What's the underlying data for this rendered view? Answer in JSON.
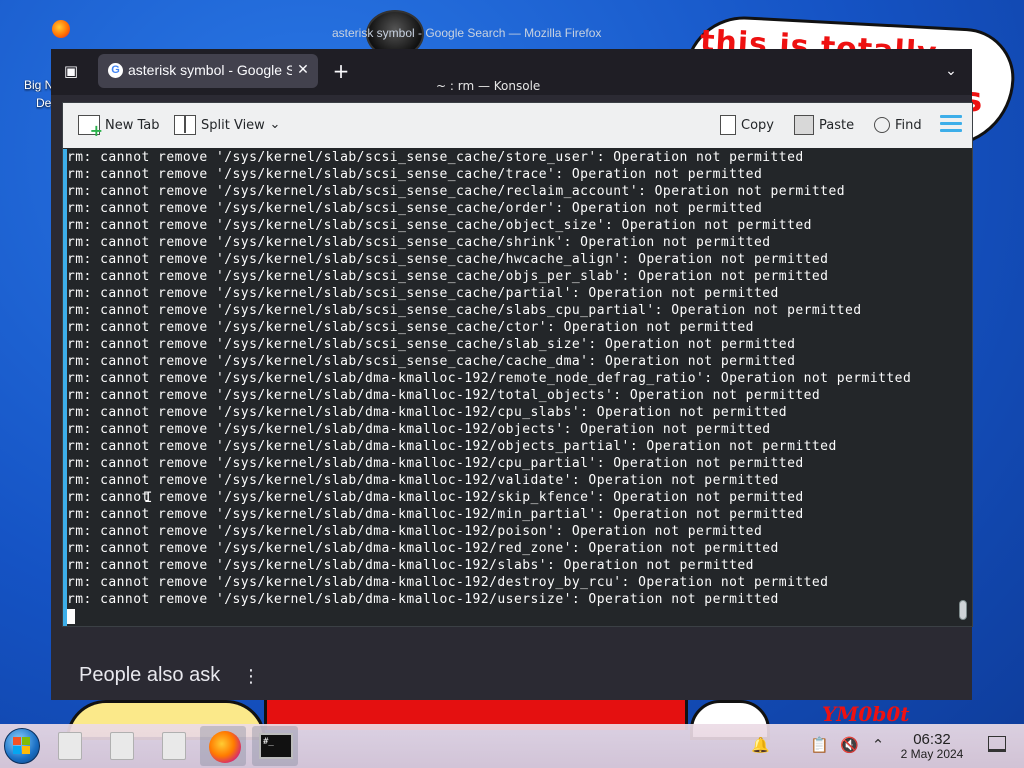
{
  "desktop": {
    "icon_label_line1": "Big N",
    "icon_label_line2": "De",
    "wallpaper_text": "this is totally",
    "wallpaper_text2": "s",
    "wallpaper_signature": "YM0b0t"
  },
  "firefox": {
    "window_title": "asterisk symbol - Google Search — Mozilla Firefox",
    "tab_title": "asterisk symbol - Google Search",
    "tab_favicon": "G",
    "new_tab_label": "+",
    "people_also_ask": "People also ask"
  },
  "konsole": {
    "window_title": "~ : rm — Konsole",
    "toolbar": {
      "new_tab": "New Tab",
      "split_view": "Split View",
      "copy": "Copy",
      "paste": "Paste",
      "find": "Find"
    },
    "lines": [
      "rm: cannot remove '/sys/kernel/slab/scsi_sense_cache/store_user': Operation not permitted",
      "rm: cannot remove '/sys/kernel/slab/scsi_sense_cache/trace': Operation not permitted",
      "rm: cannot remove '/sys/kernel/slab/scsi_sense_cache/reclaim_account': Operation not permitted",
      "rm: cannot remove '/sys/kernel/slab/scsi_sense_cache/order': Operation not permitted",
      "rm: cannot remove '/sys/kernel/slab/scsi_sense_cache/object_size': Operation not permitted",
      "rm: cannot remove '/sys/kernel/slab/scsi_sense_cache/shrink': Operation not permitted",
      "rm: cannot remove '/sys/kernel/slab/scsi_sense_cache/hwcache_align': Operation not permitted",
      "rm: cannot remove '/sys/kernel/slab/scsi_sense_cache/objs_per_slab': Operation not permitted",
      "rm: cannot remove '/sys/kernel/slab/scsi_sense_cache/partial': Operation not permitted",
      "rm: cannot remove '/sys/kernel/slab/scsi_sense_cache/slabs_cpu_partial': Operation not permitted",
      "rm: cannot remove '/sys/kernel/slab/scsi_sense_cache/ctor': Operation not permitted",
      "rm: cannot remove '/sys/kernel/slab/scsi_sense_cache/slab_size': Operation not permitted",
      "rm: cannot remove '/sys/kernel/slab/scsi_sense_cache/cache_dma': Operation not permitted",
      "rm: cannot remove '/sys/kernel/slab/dma-kmalloc-192/remote_node_defrag_ratio': Operation not permitted",
      "rm: cannot remove '/sys/kernel/slab/dma-kmalloc-192/total_objects': Operation not permitted",
      "rm: cannot remove '/sys/kernel/slab/dma-kmalloc-192/cpu_slabs': Operation not permitted",
      "rm: cannot remove '/sys/kernel/slab/dma-kmalloc-192/objects': Operation not permitted",
      "rm: cannot remove '/sys/kernel/slab/dma-kmalloc-192/objects_partial': Operation not permitted",
      "rm: cannot remove '/sys/kernel/slab/dma-kmalloc-192/cpu_partial': Operation not permitted",
      "rm: cannot remove '/sys/kernel/slab/dma-kmalloc-192/validate': Operation not permitted",
      "rm: cannot remove '/sys/kernel/slab/dma-kmalloc-192/skip_kfence': Operation not permitted",
      "rm: cannot remove '/sys/kernel/slab/dma-kmalloc-192/min_partial': Operation not permitted",
      "rm: cannot remove '/sys/kernel/slab/dma-kmalloc-192/poison': Operation not permitted",
      "rm: cannot remove '/sys/kernel/slab/dma-kmalloc-192/red_zone': Operation not permitted",
      "rm: cannot remove '/sys/kernel/slab/dma-kmalloc-192/slabs': Operation not permitted",
      "rm: cannot remove '/sys/kernel/slab/dma-kmalloc-192/destroy_by_rcu': Operation not permitted",
      "rm: cannot remove '/sys/kernel/slab/dma-kmalloc-192/usersize': Operation not permitted"
    ]
  },
  "taskbar": {
    "time": "06:32",
    "date": "2 May 2024",
    "terminal_thumb": "#_"
  },
  "colors": {
    "accent": "#3daee9",
    "terminal_bg": "#232629",
    "terminal_fg": "#fcfcfc"
  },
  "icons": [
    "firefox-icon",
    "list-all-tabs-icon",
    "google-favicon",
    "close-icon",
    "new-tab-icon",
    "chevron-down-icon",
    "kebab-menu-icon",
    "new-tab-icon",
    "split-view-icon",
    "copy-icon",
    "paste-icon",
    "find-icon",
    "hamburger-menu-icon",
    "start-orb-icon",
    "file-icon",
    "terminal-icon",
    "notification-icon",
    "clipboard-icon",
    "volume-muted-icon",
    "tray-expand-icon",
    "show-desktop-icon"
  ]
}
